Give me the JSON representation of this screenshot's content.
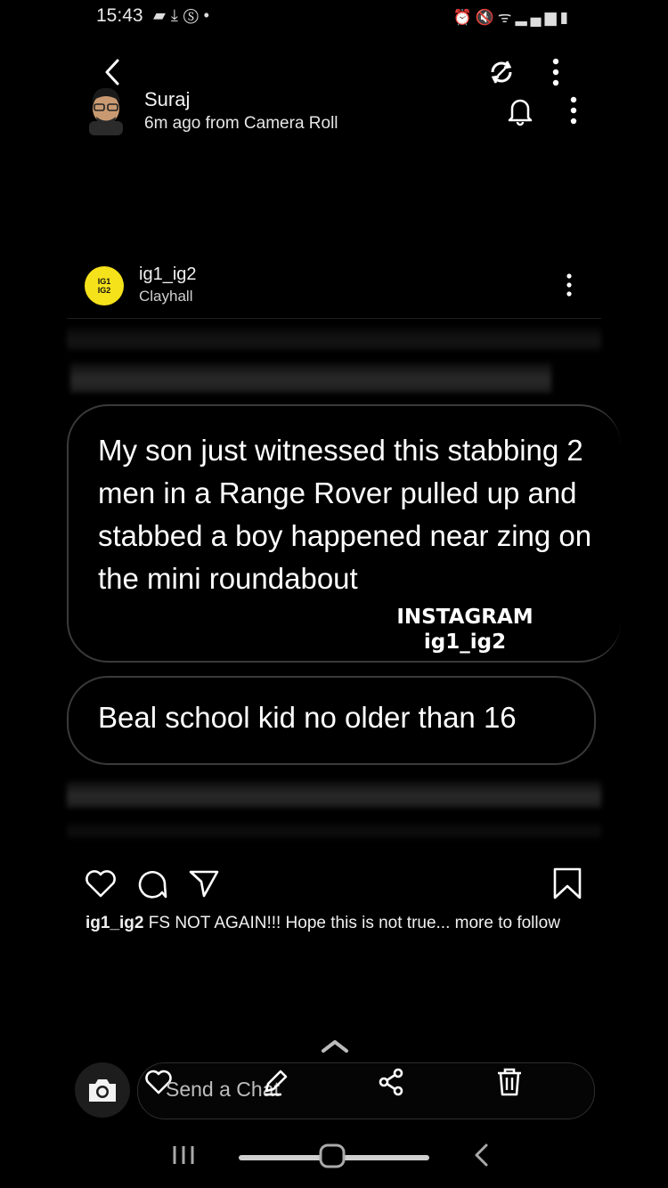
{
  "status_bar": {
    "time": "15:43",
    "left_icons": [
      "notification-icon",
      "download-icon",
      "s-app-icon",
      "dot-icon"
    ],
    "right_icons": [
      "alarm-icon",
      "mute-icon",
      "wifi-icon",
      "signal-icon",
      "signal-2-icon",
      "battery-icon"
    ]
  },
  "snap": {
    "sender_name": "Suraj",
    "sender_meta": "6m ago from Camera Roll"
  },
  "post": {
    "username": "ig1_ig2",
    "location": "Clayhall",
    "logo_text_top": "IG1",
    "logo_text_bottom": "IG2",
    "message_1": "My son just witnessed this stabbing 2 men in a Range Rover pulled up and stabbed a boy happened near zing on the mini roundabout",
    "watermark_line1": "INSTAGRAM",
    "watermark_line2": "ig1_ig2",
    "message_2": "Beal school kid no older than 16",
    "caption_user": "ig1_ig2",
    "caption_text": " FS NOT AGAIN!!! Hope this is not true... more to follow"
  },
  "bottom": {
    "chat_placeholder": "Send a Chat"
  },
  "colors": {
    "background": "#000000",
    "logo_yellow": "#f6e21a",
    "bubble_border": "#3a3a3a"
  }
}
